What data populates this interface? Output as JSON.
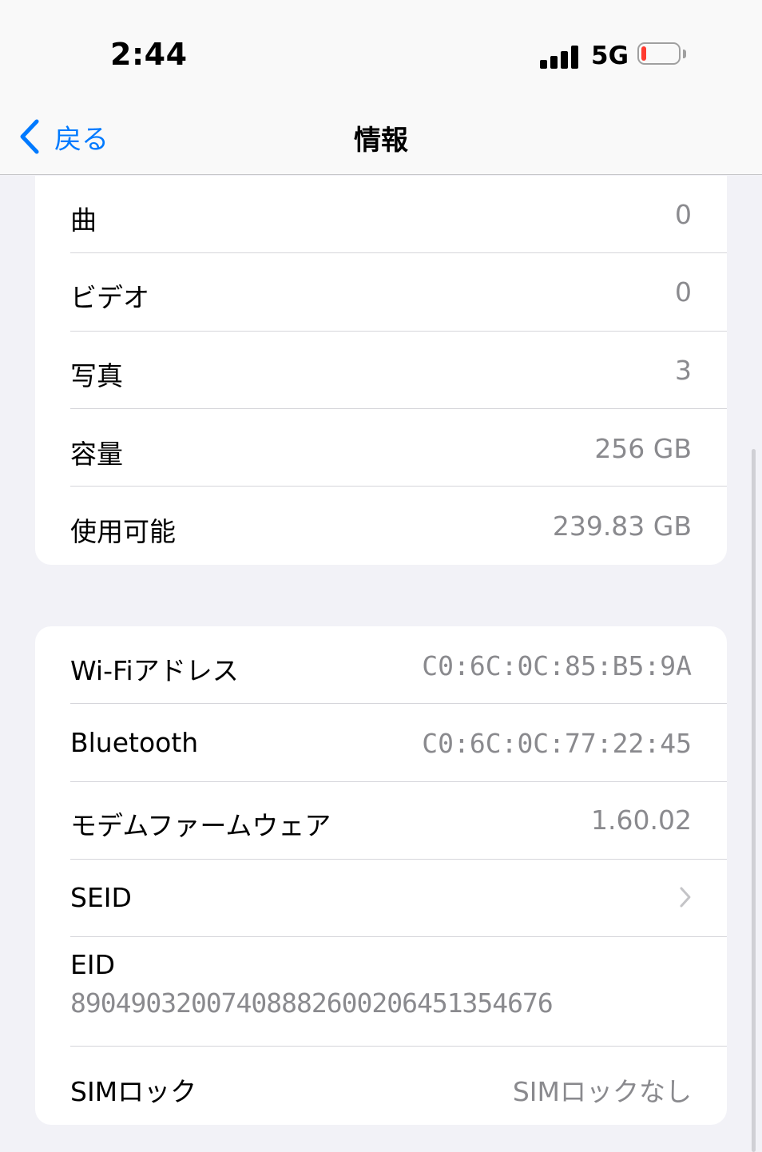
{
  "status_bar": {
    "time": "2:44",
    "network": "5G",
    "battery_level": 0.07,
    "battery_color": "#ff3b30",
    "signal_bars": 4
  },
  "nav": {
    "back_label": "戻る",
    "title": "情報",
    "back_icon": "chevron-left-icon"
  },
  "media_section": {
    "rows": [
      {
        "label": "曲",
        "value": "0"
      },
      {
        "label": "ビデオ",
        "value": "0"
      },
      {
        "label": "写真",
        "value": "3"
      },
      {
        "label": "容量",
        "value": "256 GB"
      },
      {
        "label": "使用可能",
        "value": "239.83 GB"
      }
    ]
  },
  "network_section": {
    "wifi": {
      "label": "Wi-Fiアドレス",
      "value": "C0:6C:0C:85:B5:9A"
    },
    "bluetooth": {
      "label": "Bluetooth",
      "value": "C0:6C:0C:77:22:45"
    },
    "modem": {
      "label": "モデムファームウェア",
      "value": "1.60.02"
    },
    "seid": {
      "label": "SEID",
      "icon": "chevron-right-icon"
    },
    "eid": {
      "label": "EID",
      "value": "89049032007408882600206451354676"
    },
    "sim_lock": {
      "label": "SIMロック",
      "value": "SIMロックなし"
    }
  },
  "colors": {
    "accent": "#007aff",
    "background": "#f2f2f7",
    "secondary_text": "#8a8a8e"
  }
}
